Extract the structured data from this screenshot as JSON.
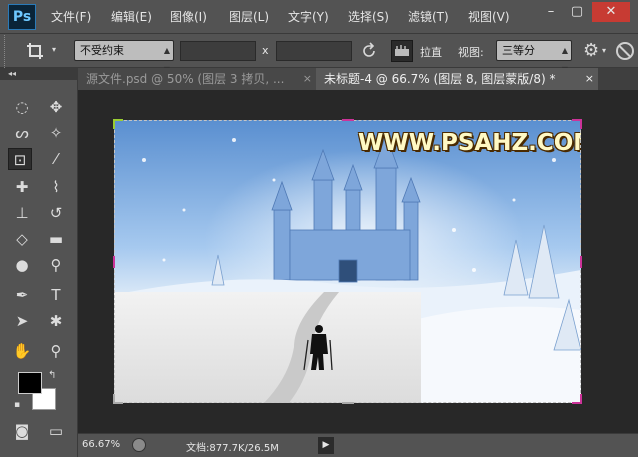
{
  "app": {
    "logo": "Ps"
  },
  "menu": [
    "文件(F)",
    "编辑(E)",
    "图像(I)",
    "图层(L)",
    "文字(Y)",
    "选择(S)",
    "滤镜(T)",
    "视图(V)"
  ],
  "window_controls": {
    "minimize": "–",
    "restore": "▢",
    "close": "✕"
  },
  "options": {
    "crop_icon": "crop-icon",
    "ratio_select": "不受约束",
    "width_value": "",
    "height_value": "",
    "times_sign": "x",
    "straighten_label": "拉直",
    "view_label": "视图:",
    "view_select": "三等分"
  },
  "toolbar": {
    "collapse": "◂◂"
  },
  "tabs": [
    {
      "label": "源文件.psd @ 50% (图层 3 拷贝, ...",
      "close": "×",
      "active": false
    },
    {
      "label": "未标题-4 @ 66.7% (图层 8, 图层蒙版/8) *",
      "close": "×",
      "active": true
    }
  ],
  "canvas": {
    "watermark": "WWW.PSAHZ.COM"
  },
  "status": {
    "zoom": "66.67%",
    "doc_info": "文档:877.7K/26.5M",
    "arrow": "▶"
  },
  "colors": {
    "foreground": "#000000",
    "background": "#ffffff",
    "accent": "#2a7ab8"
  }
}
